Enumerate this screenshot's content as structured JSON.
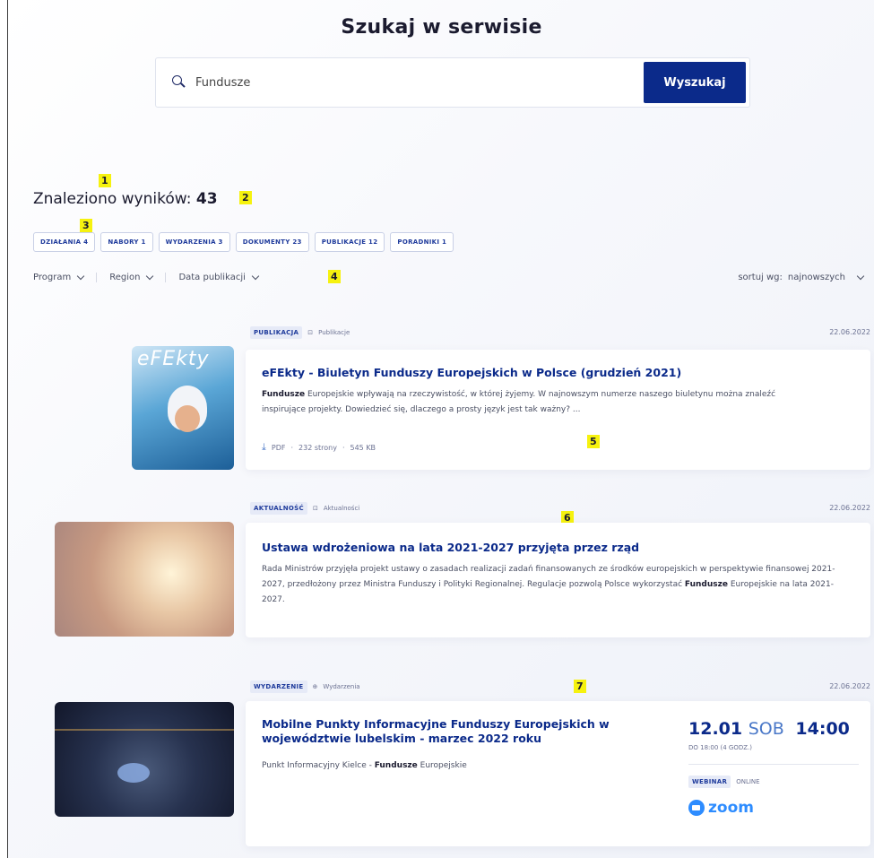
{
  "page": {
    "title": "Szukaj w serwisie"
  },
  "search": {
    "value": "Fundusze",
    "button_label": "Wyszukaj"
  },
  "results": {
    "label": "Znaleziono wyników:",
    "count": "43"
  },
  "filter_tags": [
    "DZIAŁANIA 4",
    "NABORY 1",
    "WYDARZENIA 3",
    "DOKUMENTY 23",
    "PUBLIKACJE 12",
    "PORADNIKI 1"
  ],
  "filters": {
    "program": "Program",
    "region": "Region",
    "date": "Data publikacji",
    "sort_label": "sortuj wg:",
    "sort_value": "najnowszych"
  },
  "markers": [
    "1",
    "2",
    "3",
    "4",
    "5",
    "6",
    "7"
  ],
  "items": [
    {
      "type": "PUBLIKACJA",
      "category": "Publikacje",
      "date": "22.06.2022",
      "title": "eFEkty - Biuletyn Funduszy Europejskich w Polsce (grudzień 2021)",
      "text_bold": "Fundusze",
      "text_rest": " Europejskie wpływają na rzeczywistość, w której żyjemy. W najnowszym numerze naszego biuletynu można znaleźć inspirujące projekty. Dowiedzieć się, dlaczego a prosty język jest tak ważny? ...",
      "file_type": "PDF",
      "pages": "232 strony",
      "size": "545 KB",
      "thumb_text": "eFEkty"
    },
    {
      "type": "AKTUALNOŚĆ",
      "category": "Aktualności",
      "date": "22.06.2022",
      "title": "Ustawa wdrożeniowa na lata 2021-2027 przyjęta przez rząd",
      "text_rest": "Rada Ministrów przyjęła projekt ustawy o zasadach realizacji zadań finansowanych ze środków europejskich w perspektywie finansowej 2021-2027, przedłożony przez Ministra Funduszy i Polityki Regionalnej. Regulacje pozwolą Polsce wykorzystać ",
      "text_bold": "Fundusze",
      "text_end": " Europejskie na lata 2021-2027."
    },
    {
      "type": "WYDARZENIE",
      "category": "Wydarzenia",
      "date": "22.06.2022",
      "title": "Mobilne Punkty Informacyjne Funduszy Europejskich w województwie lubelskim - marzec 2022 roku",
      "text_start": "Punkt Informacyjny Kielce - ",
      "text_bold": "Fundusze",
      "text_end": " Europejskie",
      "event_day": "12.01",
      "event_weekday": "SOB",
      "event_time": "14:00",
      "event_until": "DO 18:00 (4 GODZ.)",
      "event_kind": "WEBINAR",
      "event_mode": "ONLINE",
      "platform": "zoom"
    }
  ],
  "colors": {
    "accent": "#0b2a8a",
    "marker": "#f6f20f",
    "zoom": "#2d8cff"
  }
}
